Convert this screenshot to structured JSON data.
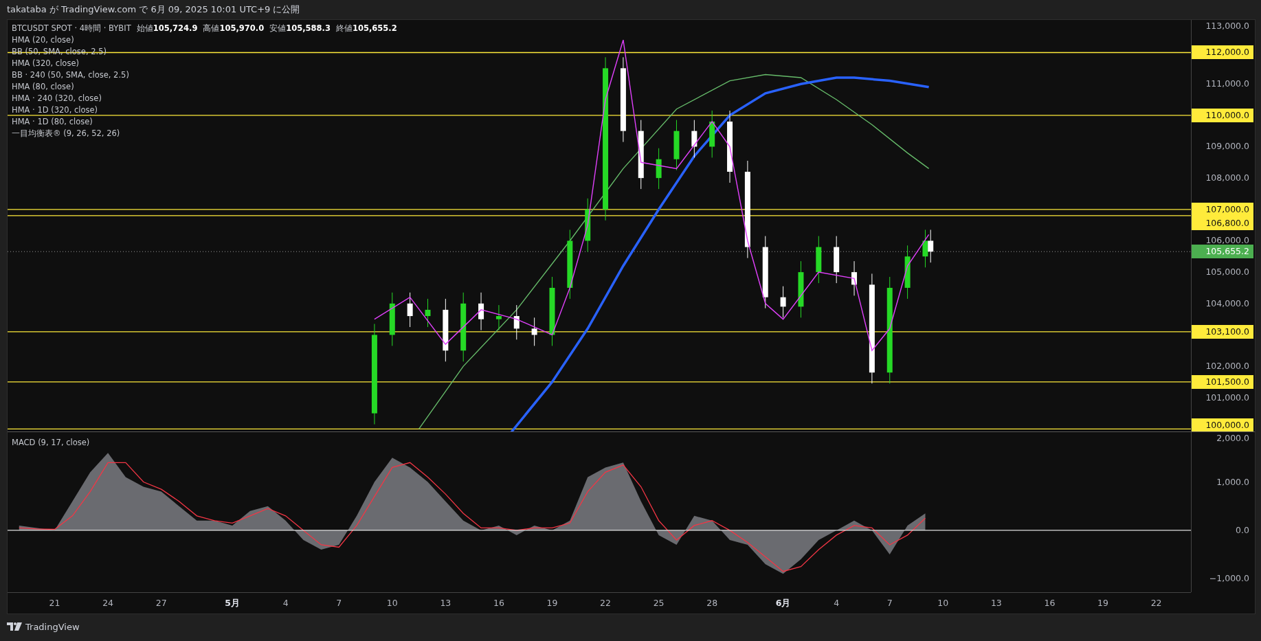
{
  "header": {
    "text": "takataba が TradingView.com で 6月 09, 2025 10:01 UTC+9 に公開"
  },
  "legend": {
    "symbol": "BTCUSDT SPOT · 4時間 · BYBIT",
    "ohlc": [
      "始値**105,724.9**",
      "高値**105,970.0**",
      "安値**105,588.3**",
      "終値**105,655.2**"
    ],
    "indicators": [
      "HMA (20, close)",
      "BB (50, SMA, close, 2.5)",
      "HMA (320, close)",
      "BB · 240 (50, SMA, close, 2.5)",
      "HMA (80, close)",
      "HMA · 240 (320, close)",
      "HMA · 1D (320, close)",
      "HMA · 1D (80, close)",
      "一目均衡表® (9, 26, 52, 26)"
    ]
  },
  "price_axis": {
    "ticks": [
      "113,000.0",
      "111,000.0",
      "109,000.0",
      "108,000.0",
      "106,000.0",
      "105,000.0",
      "104,000.0",
      "102,000.0",
      "101,000.0"
    ],
    "levels": [
      "112,000.0",
      "110,000.0",
      "107,000.0",
      "106,800.0",
      "103,100.0",
      "101,500.0",
      "100,000.0"
    ],
    "last_price": "105,655.2"
  },
  "macd_pane": {
    "legend": "MACD (9, 17, close)",
    "ticks": [
      "2,000.0",
      "1,000.0",
      "0.0",
      "−1,000.0"
    ]
  },
  "time_axis": [
    {
      "label": "21",
      "month": false
    },
    {
      "label": "24",
      "month": false
    },
    {
      "label": "27",
      "month": false
    },
    {
      "label": "5月",
      "month": true
    },
    {
      "label": "4",
      "month": false
    },
    {
      "label": "7",
      "month": false
    },
    {
      "label": "10",
      "month": false
    },
    {
      "label": "13",
      "month": false
    },
    {
      "label": "16",
      "month": false
    },
    {
      "label": "19",
      "month": false
    },
    {
      "label": "22",
      "month": false
    },
    {
      "label": "25",
      "month": false
    },
    {
      "label": "28",
      "month": false
    },
    {
      "label": "6月",
      "month": true
    },
    {
      "label": "4",
      "month": false
    },
    {
      "label": "7",
      "month": false
    },
    {
      "label": "10",
      "month": false
    },
    {
      "label": "13",
      "month": false
    },
    {
      "label": "16",
      "month": false
    },
    {
      "label": "19",
      "month": false
    },
    {
      "label": "22",
      "month": false
    }
  ],
  "footer": {
    "brand": "TradingView"
  }
}
